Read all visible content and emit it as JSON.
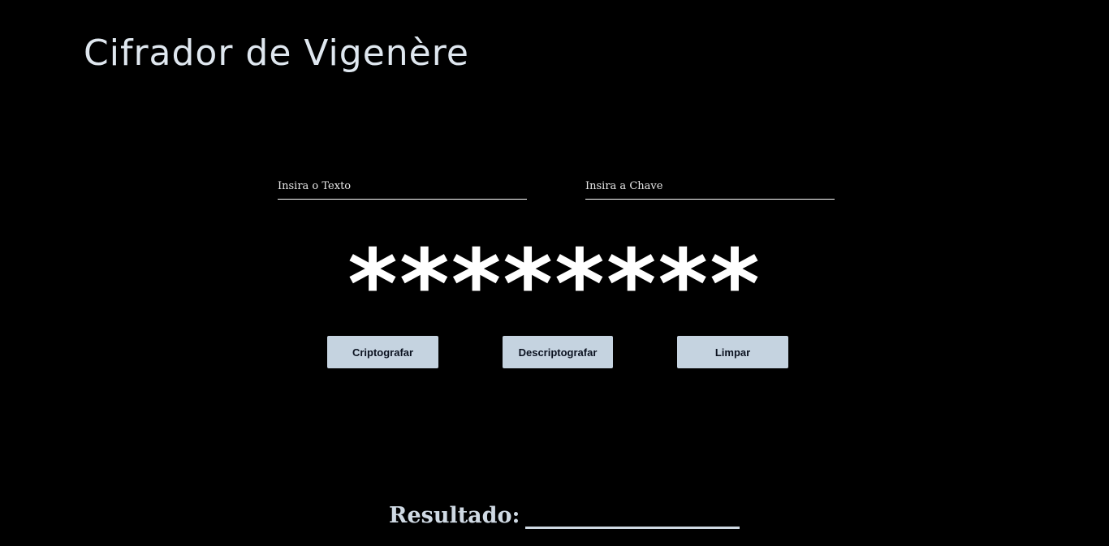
{
  "header": {
    "title": "Cifrador de Vigenère"
  },
  "form": {
    "text_placeholder": "Insira o Texto",
    "text_value": "",
    "key_placeholder": "Insira a Chave",
    "key_value": ""
  },
  "display": {
    "masked": "********"
  },
  "actions": {
    "encrypt_label": "Criptografar",
    "decrypt_label": "Descriptografar",
    "clear_label": "Limpar"
  },
  "result": {
    "label": "Resultado:",
    "value": ""
  },
  "colors": {
    "background": "#000000",
    "title": "#dfe7ef",
    "button_bg": "#c5d3e0",
    "button_text": "#0b1220",
    "result_text": "#cfd9e3"
  }
}
